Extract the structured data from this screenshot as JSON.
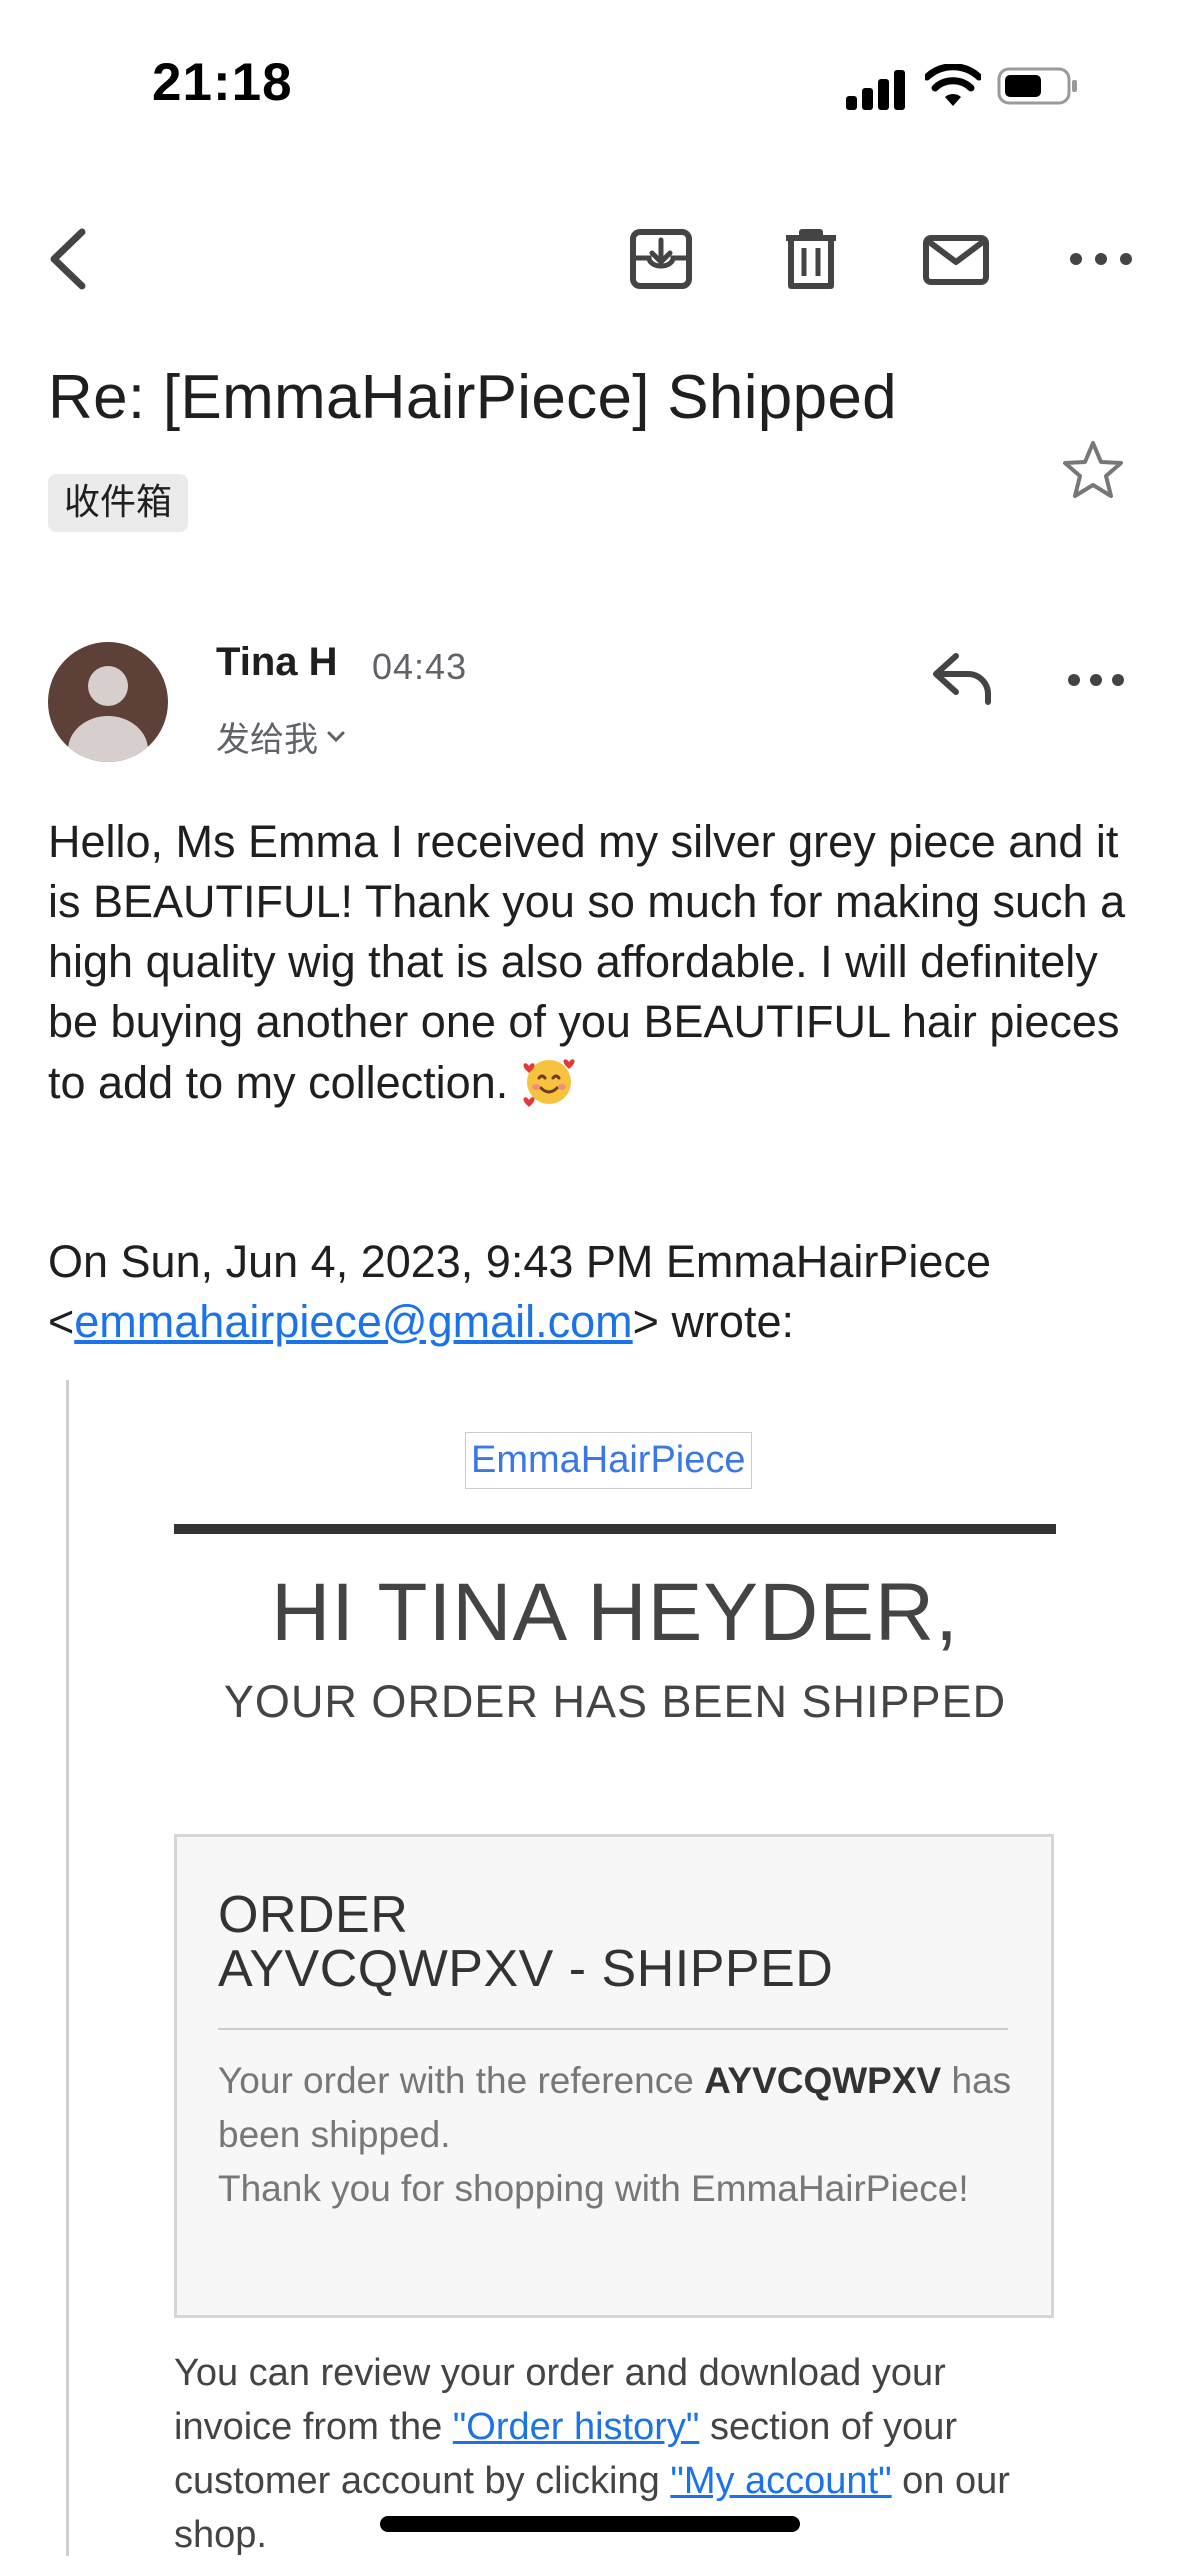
{
  "status_bar": {
    "time": "21:18"
  },
  "toolbar": {
    "back_icon": "chevron-left-icon",
    "archive_icon": "archive-icon",
    "delete_icon": "trash-icon",
    "unread_icon": "mail-icon",
    "more_icon": "more-horizontal-icon"
  },
  "email": {
    "subject": "Re: [EmmaHairPiece] Shipped",
    "label": "收件箱",
    "sender_name": "Tina H",
    "time": "04:43",
    "recipient": "发给我",
    "body": "Hello, Ms Emma I received my silver grey piece and it is BEAUTIFUL! Thank you so much for making such a high quality wig that is also affordable. I will definitely be buying another one of you BEAUTIFUL hair pieces to add to my collection.",
    "quote_header_before": "On Sun, Jun 4, 2023, 9:43 PM EmmaHairPiece <",
    "quote_email": "emmahairpiece@gmail.com",
    "quote_header_after": "> wrote:"
  },
  "quoted": {
    "brand": "EmmaHairPiece",
    "greeting": "HI TINA HEYDER,",
    "subheading": "YOUR ORDER HAS BEEN SHIPPED",
    "order_title_1": "ORDER",
    "order_title_2": "AYVCQWPXV - SHIPPED",
    "msg_prefix": "Your order with the reference ",
    "reference": "AYVCQWPXV",
    "msg_suffix": " has been shipped.",
    "thanks": "Thank you for shopping with EmmaHairPiece!",
    "footer_1": "You can review your order and download your invoice from the ",
    "order_history_link": "\"Order history\"",
    "footer_2": " section of your customer account by clicking ",
    "my_account_link": "\"My account\"",
    "footer_3": " on our shop."
  }
}
